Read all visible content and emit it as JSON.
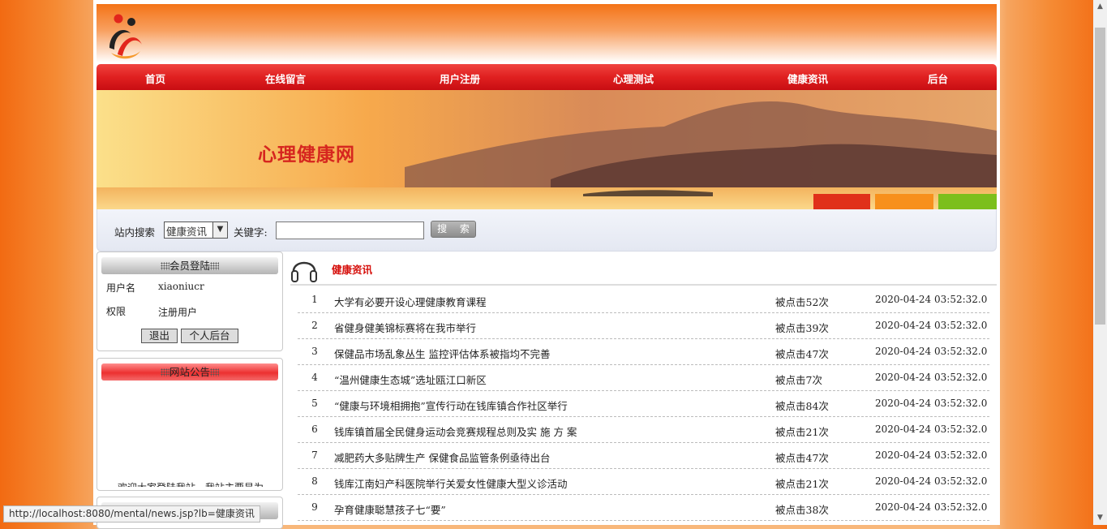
{
  "site": {
    "title": "心理健康网"
  },
  "nav": [
    "首页",
    "在线留言",
    "用户注册",
    "心理测试",
    "健康资讯",
    "后台"
  ],
  "search": {
    "label": "站内搜索",
    "category": "健康资讯",
    "keyword_label": "关键字:",
    "keyword_value": "",
    "button": "搜 索"
  },
  "member": {
    "header": "会员登陆",
    "username_label": "用户名",
    "username": "xiaoniucr",
    "role_label": "权限",
    "role": "注册用户",
    "logout": "退出",
    "profile": "个人后台"
  },
  "notice": {
    "header": "网站公告",
    "text": "欢迎大家登陆我站，我站主要是为"
  },
  "news": {
    "heading": "健康资讯",
    "items": [
      {
        "no": "1",
        "title": "大学有必要开设心理健康教育课程",
        "clicks": "被点击52次",
        "date": "2020-04-24 03:52:32.0"
      },
      {
        "no": "2",
        "title": "省健身健美锦标赛将在我市举行",
        "clicks": "被点击39次",
        "date": "2020-04-24 03:52:32.0"
      },
      {
        "no": "3",
        "title": "保健品市场乱象丛生 监控评估体系被指均不完善",
        "clicks": "被点击47次",
        "date": "2020-04-24 03:52:32.0"
      },
      {
        "no": "4",
        "title": "“温州健康生态城”选址瓯江口新区",
        "clicks": "被点击7次",
        "date": "2020-04-24 03:52:32.0"
      },
      {
        "no": "5",
        "title": "“健康与环境相拥抱”宣传行动在钱库镇合作社区举行",
        "clicks": "被点击84次",
        "date": "2020-04-24 03:52:32.0"
      },
      {
        "no": "6",
        "title": "钱库镇首届全民健身运动会竞赛规程总则及实 施 方 案",
        "clicks": "被点击21次",
        "date": "2020-04-24 03:52:32.0"
      },
      {
        "no": "7",
        "title": "减肥药大多贴牌生产 保健食品监管条例亟待出台",
        "clicks": "被点击47次",
        "date": "2020-04-24 03:52:32.0"
      },
      {
        "no": "8",
        "title": "钱库江南妇产科医院举行关爱女性健康大型义诊活动",
        "clicks": "被点击21次",
        "date": "2020-04-24 03:52:32.0"
      },
      {
        "no": "9",
        "title": "孕育健康聪慧孩子七“要”",
        "clicks": "被点击38次",
        "date": "2020-04-24 03:52:32.0"
      }
    ]
  },
  "status_bar": "http://localhost:8080/mental/news.jsp?lb=健康资讯",
  "colors": {
    "nav_red": "#e02020",
    "heading_red": "#d6100c",
    "banner_title": "#d6261f"
  }
}
